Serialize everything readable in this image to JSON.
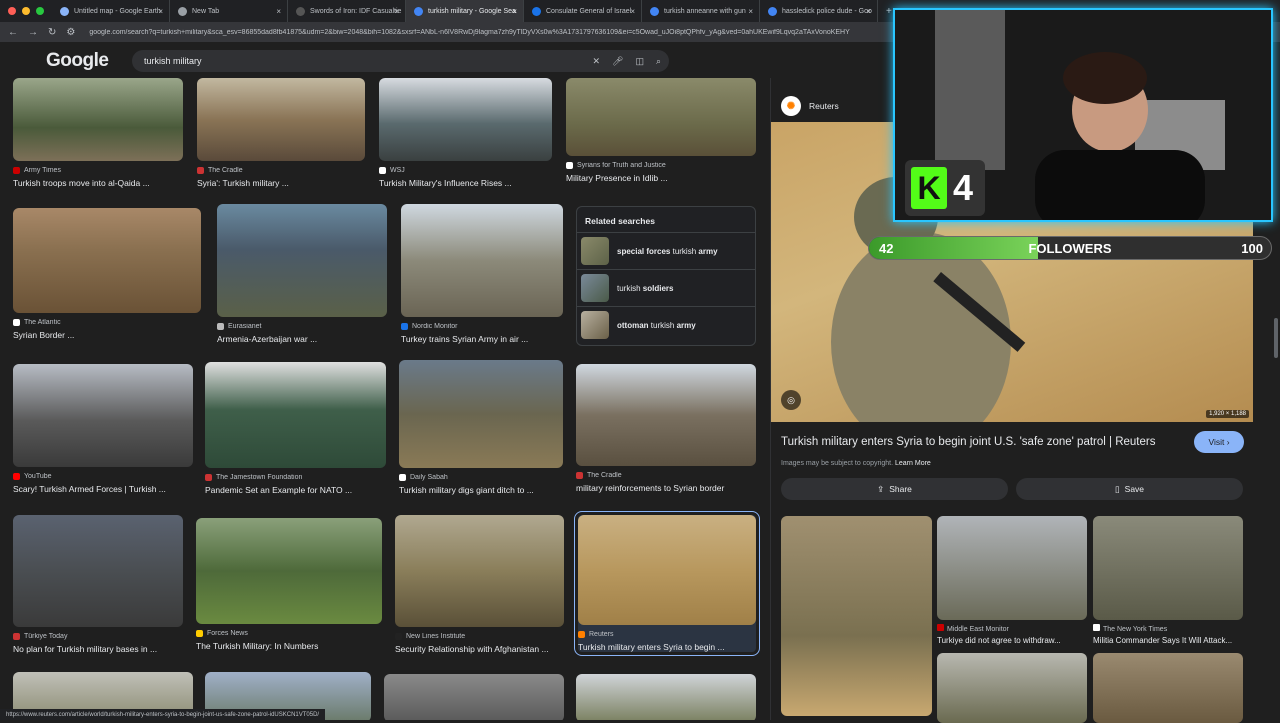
{
  "tabs": [
    {
      "label": "Untitled map - Google Earth",
      "active": false
    },
    {
      "label": "New Tab",
      "active": false
    },
    {
      "label": "Swords of Iron: IDF Casualtie",
      "active": false
    },
    {
      "label": "turkish military - Google Sea",
      "active": true
    },
    {
      "label": "Consulate General of Israel",
      "active": false
    },
    {
      "label": "turkish anneanne with gun",
      "active": false
    },
    {
      "label": "hassledick police dude - Goo",
      "active": false
    }
  ],
  "url": "google.com/search?q=turkish+military&sca_esv=86855dad8fb41875&udm=2&biw=2048&bih=1082&sxsrf=ANbL-n6lV8RwDj9lagma7zh9yTlDyVXs0w%3A1731797636109&ei=c5Owad_uJOi8ptQPhfv_yAg&ved=0ahUKEwif9Lqvq2aTAxVonoKEHY",
  "logo": "Google",
  "search_query": "turkish military",
  "results": [
    {
      "source": "Army Times",
      "title": "Turkish troops move into al-Qaida ...",
      "color": "#4a5a3a"
    },
    {
      "source": "The Cradle",
      "title": "Syria': Turkish military ...",
      "color": "#8a7456"
    },
    {
      "source": "WSJ",
      "title": "Turkish Military's Influence Rises ...",
      "color": "#5a6a6e"
    },
    {
      "source": "Syrians for Truth and Justice",
      "title": "Military Presence in Idlib ...",
      "color": "#6b6a4a"
    },
    {
      "source": "The Atlantic",
      "title": "Syrian Border ...",
      "color": "#8a7050"
    },
    {
      "source": "Eurasianet",
      "title": "Armenia-Azerbaijan war ...",
      "color": "#4a5a6a"
    },
    {
      "source": "Nordic Monitor",
      "title": "Turkey trains Syrian Army in air ...",
      "color": "#8c8a7a"
    },
    {
      "source": "YouTube",
      "title": "Scary! Turkish Armed Forces | Turkish ...",
      "color": "#5a5a5a"
    },
    {
      "source": "The Jamestown Foundation",
      "title": "Pandemic Set an Example for NATO ...",
      "color": "#3f5f4a"
    },
    {
      "source": "Daily Sabah",
      "title": "Turkish military digs giant ditch to ...",
      "color": "#6a6650"
    },
    {
      "source": "The Cradle",
      "title": "military reinforcements to Syrian border",
      "color": "#7a7060"
    },
    {
      "source": "Türkiye Today",
      "title": "No plan for Turkish military bases in ...",
      "color": "#4a4e52"
    },
    {
      "source": "Forces News",
      "title": "The Turkish Military: In Numbers",
      "color": "#4e6a3a"
    },
    {
      "source": "New Lines Institute",
      "title": "Security Relationship with Afghanistan ...",
      "color": "#8a7e5a"
    },
    {
      "source": "Reuters",
      "title": "Turkish military enters Syria to begin ...",
      "color": "#b8985e"
    }
  ],
  "related": {
    "heading": "Related searches",
    "items": [
      {
        "bold1": "special forces",
        "normal": " turkish ",
        "bold2": "army"
      },
      {
        "bold1": "",
        "normal": "turkish ",
        "bold2": "soldiers"
      },
      {
        "bold1": "ottoman",
        "normal": " turkish ",
        "bold2": "army"
      }
    ]
  },
  "panel": {
    "source": "Reuters",
    "dimensions": "1,920 × 1,188",
    "title": "Turkish military enters Syria to begin joint U.S. 'safe zone' patrol | Reuters",
    "visit": "Visit",
    "copyright": "Images may be subject to copyright.",
    "learn_more": "Learn More",
    "share": "Share",
    "save": "Save",
    "similar": [
      {
        "source": "Middle East Monitor",
        "title": "Turkiye did not agree to withdraw..."
      },
      {
        "source": "The New York Times",
        "title": "Militia Commander Says It Will Attack..."
      }
    ]
  },
  "overlay": {
    "kick_number": "4",
    "followers_current": "42",
    "followers_label": "FOLLOWERS",
    "followers_goal": "100",
    "followers_progress": 0.42
  },
  "status_url": "https://www.reuters.com/article/world/turkish-military-enters-syria-to-begin-joint-us-safe-zone-patrol-idUSKCN1VT05D/",
  "colors": {
    "accent": "#8ab4f8",
    "kick_green": "#53fc18",
    "overlay_border": "#29c6ff"
  }
}
